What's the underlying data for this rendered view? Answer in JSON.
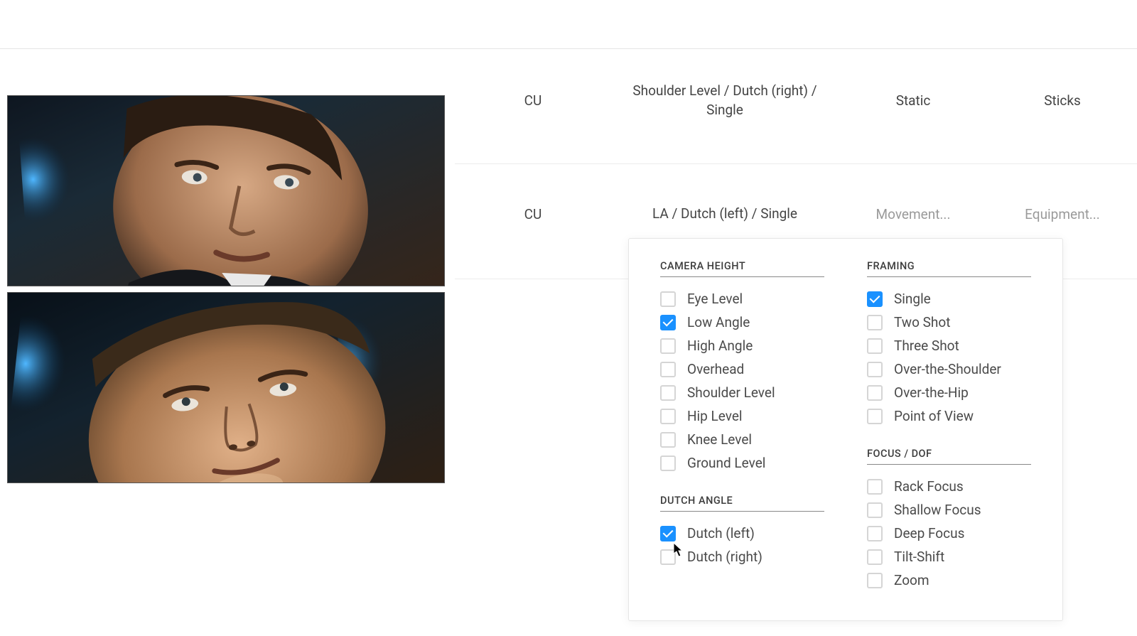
{
  "rows": [
    {
      "size": "CU",
      "angle": "Shoulder Level / Dutch (right) / Single",
      "movement": "Static",
      "equipment": "Sticks"
    },
    {
      "size": "CU",
      "angle": "LA / Dutch (left) / Single",
      "movement_placeholder": "Movement...",
      "equipment_placeholder": "Equipment..."
    }
  ],
  "panel": {
    "sections": {
      "camera_height": {
        "header": "CAMERA HEIGHT",
        "options": [
          {
            "label": "Eye Level",
            "checked": false
          },
          {
            "label": "Low Angle",
            "checked": true
          },
          {
            "label": "High Angle",
            "checked": false
          },
          {
            "label": "Overhead",
            "checked": false
          },
          {
            "label": "Shoulder Level",
            "checked": false
          },
          {
            "label": "Hip Level",
            "checked": false
          },
          {
            "label": "Knee Level",
            "checked": false
          },
          {
            "label": "Ground Level",
            "checked": false
          }
        ]
      },
      "dutch_angle": {
        "header": "DUTCH ANGLE",
        "options": [
          {
            "label": "Dutch (left)",
            "checked": true
          },
          {
            "label": "Dutch (right)",
            "checked": false
          }
        ]
      },
      "framing": {
        "header": "FRAMING",
        "options": [
          {
            "label": "Single",
            "checked": true
          },
          {
            "label": "Two Shot",
            "checked": false
          },
          {
            "label": "Three Shot",
            "checked": false
          },
          {
            "label": "Over-the-Shoulder",
            "checked": false
          },
          {
            "label": "Over-the-Hip",
            "checked": false
          },
          {
            "label": "Point of View",
            "checked": false
          }
        ]
      },
      "focus_dof": {
        "header": "FOCUS / DOF",
        "options": [
          {
            "label": "Rack Focus",
            "checked": false
          },
          {
            "label": "Shallow Focus",
            "checked": false
          },
          {
            "label": "Deep Focus",
            "checked": false
          },
          {
            "label": "Tilt-Shift",
            "checked": false
          },
          {
            "label": "Zoom",
            "checked": false
          }
        ]
      }
    }
  }
}
